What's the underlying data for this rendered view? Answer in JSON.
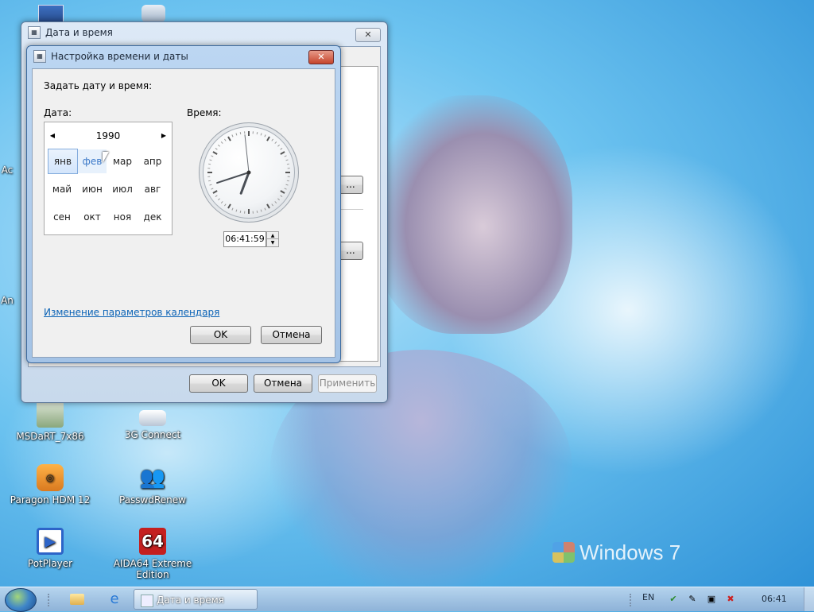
{
  "desktop": {
    "icons": [
      {
        "label": "MSDaRT_7x86"
      },
      {
        "label": "3G Connect"
      },
      {
        "label": "Paragon HDM 12"
      },
      {
        "label": "PasswdRenew"
      },
      {
        "label": "PotPlayer"
      },
      {
        "label": "AIDA64 Extreme Edition",
        "badge": "64"
      }
    ],
    "left_edge_labels": [
      "Ac",
      "An"
    ],
    "watermark": "Windows 7"
  },
  "outer_window": {
    "title": "Дата и время",
    "ok_label": "OK",
    "cancel_label": "Отмена",
    "apply_label": "Применить",
    "partial_button_label": "..."
  },
  "dialog": {
    "title": "Настройка времени и даты",
    "heading": "Задать дату и время:",
    "date_label": "Дата:",
    "time_label": "Время:",
    "calendar": {
      "year": "1990",
      "prev_icon": "triangle-left-icon",
      "next_icon": "triangle-right-icon",
      "months": [
        "янв",
        "фев",
        "мар",
        "апр",
        "май",
        "июн",
        "июл",
        "авг",
        "сен",
        "окт",
        "ноя",
        "дек"
      ],
      "selected": "янв",
      "hovered": "фев"
    },
    "clock": {
      "hours": 6,
      "minutes": 41,
      "seconds": 59
    },
    "time_value": "06:41:59",
    "calendar_link": "Изменение параметров календаря",
    "ok_label": "OK",
    "cancel_label": "Отмена"
  },
  "taskbar": {
    "task_label": "Дата и время",
    "language": "EN",
    "clock": "06:41"
  }
}
